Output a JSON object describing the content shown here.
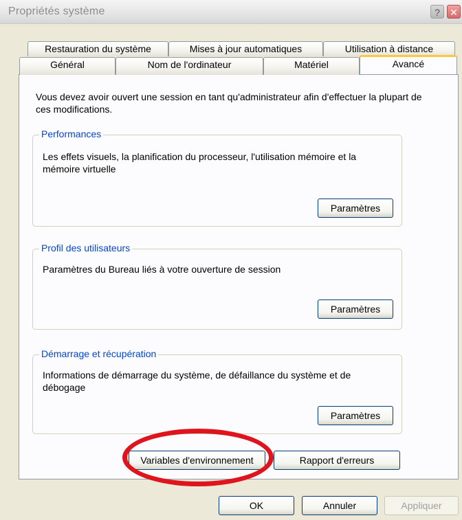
{
  "window": {
    "title": "Propriétés système",
    "help_button": "?",
    "close_button": "✕"
  },
  "tabs": {
    "row1": [
      "Restauration du système",
      "Mises à jour automatiques",
      "Utilisation à distance"
    ],
    "row2": [
      "Général",
      "Nom de l'ordinateur",
      "Matériel",
      "Avancé"
    ],
    "active": "Avancé"
  },
  "advanced": {
    "intro": "Vous devez avoir ouvert une session en tant qu'administrateur afin d'effectuer la plupart de ces modifications.",
    "performance": {
      "label": "Performances",
      "description": "Les effets visuels, la planification du processeur, l'utilisation mémoire et la mémoire virtuelle",
      "button": "Paramètres"
    },
    "user_profiles": {
      "label": "Profil des utilisateurs",
      "description": "Paramètres du Bureau liés à votre ouverture de session",
      "button": "Paramètres"
    },
    "startup_recovery": {
      "label": "Démarrage et récupération",
      "description": "Informations de démarrage du système, de défaillance du système et de débogage",
      "button": "Paramètres"
    },
    "env_vars_button": "Variables d'environnement",
    "error_report_button": "Rapport d'erreurs"
  },
  "footer": {
    "ok": "OK",
    "cancel": "Annuler",
    "apply": "Appliquer"
  },
  "colors": {
    "highlight_circle": "#e0141c",
    "group_label": "#0046d5",
    "active_tab_accent": "#ffc83c"
  }
}
